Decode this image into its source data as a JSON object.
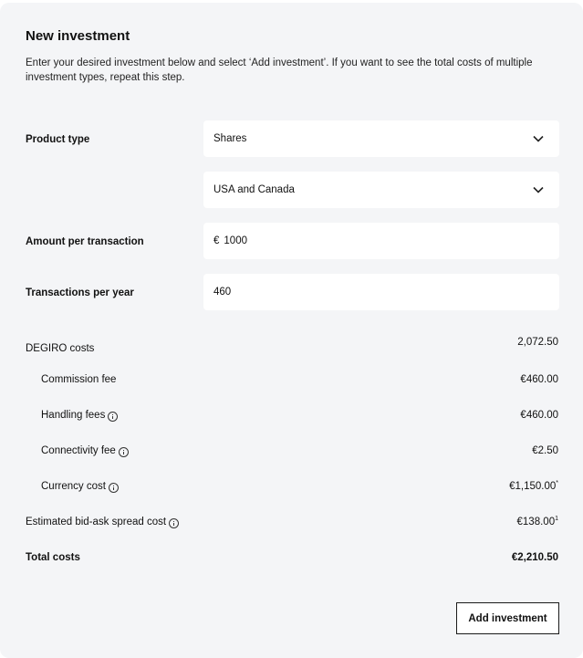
{
  "form": {
    "title": "New investment",
    "description": "Enter your desired investment below and select ‘Add investment’. If you want to see the total costs of multiple investment types, repeat this step.",
    "product_type_label": "Product type",
    "product_type_value": "Shares",
    "region_value": "USA and Canada",
    "amount_label": "Amount per transaction",
    "amount_currency": "€",
    "amount_value": "1000",
    "transactions_label": "Transactions per year",
    "transactions_value": "460"
  },
  "costs": {
    "degiro_label": "DEGIRO costs",
    "degiro_value": "2,072.50",
    "commission_label": "Commission fee",
    "commission_value": "€460.00",
    "handling_label": "Handling fees",
    "handling_value": "€460.00",
    "connectivity_label": "Connectivity fee",
    "connectivity_value": "€2.50",
    "currency_label": "Currency cost",
    "currency_value": "€1,150.00",
    "currency_footnote": "*",
    "spread_label": "Estimated bid-ask spread cost",
    "spread_value": "€138.00",
    "spread_footnote": "1",
    "total_label": "Total costs",
    "total_value": "€2,210.50"
  },
  "actions": {
    "add_label": "Add investment"
  },
  "icons": {
    "dropdown": "chevron-down-icon",
    "info": "info-icon"
  }
}
